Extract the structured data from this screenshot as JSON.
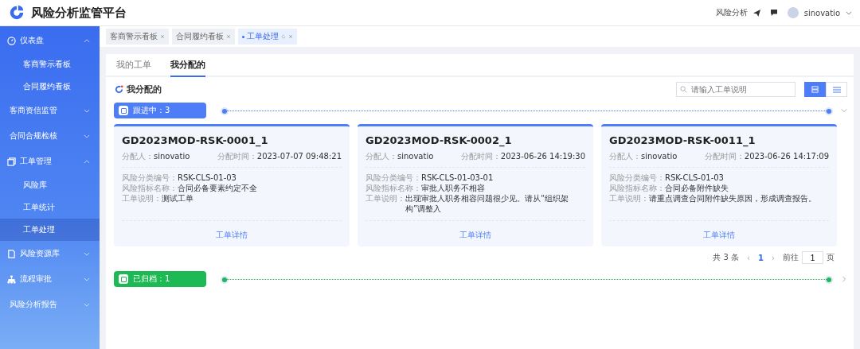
{
  "header": {
    "title": "风险分析监管平台",
    "link": "风险分析",
    "user": "sinovatio"
  },
  "sidebar": {
    "items": [
      {
        "label": "仪表盘",
        "expanded": true,
        "selected": false,
        "children": [
          {
            "label": "客商警示看板",
            "selected": false
          },
          {
            "label": "合同履约看板",
            "selected": false
          }
        ]
      },
      {
        "label": "客商资信监管",
        "expanded": false,
        "selected": false
      },
      {
        "label": "合同合规检核",
        "expanded": false,
        "selected": false
      },
      {
        "label": "工单管理",
        "expanded": true,
        "selected": false,
        "children": [
          {
            "label": "风险库",
            "selected": false
          },
          {
            "label": "工单统计",
            "selected": false
          },
          {
            "label": "工单处理",
            "selected": true
          }
        ]
      },
      {
        "label": "风险资源库",
        "expanded": false,
        "selected": false
      },
      {
        "label": "流程审批",
        "expanded": false,
        "selected": false
      },
      {
        "label": "风险分析报告",
        "expanded": false,
        "selected": false
      }
    ]
  },
  "open_tabs": [
    {
      "label": "客商警示看板",
      "selected": false
    },
    {
      "label": "合同履约看板",
      "selected": false
    },
    {
      "label": "工单处理",
      "selected": true
    }
  ],
  "page_tabs": [
    {
      "label": "我的工单",
      "selected": false
    },
    {
      "label": "我分配的",
      "selected": true
    }
  ],
  "section_title": "我分配的",
  "search": {
    "placeholder": "请输入工单说明"
  },
  "view_modes": [
    {
      "kind": "cards",
      "selected": true
    },
    {
      "kind": "list",
      "selected": false
    }
  ],
  "groups": [
    {
      "kind": "in_progress",
      "label": "跟进中：3",
      "expanded": true,
      "cards": [
        {
          "title": "GD2023MOD-RSK-0001_1",
          "assignee_label": "分配人：",
          "assignee": "sinovatio",
          "time_label": "分配时间：",
          "time": "2023-07-07 09:48:21",
          "fields": [
            {
              "label": "风险分类编号：",
              "value": "RSK-CLS-01-03"
            },
            {
              "label": "风险指标名称：",
              "value": "合同必备要素约定不全"
            },
            {
              "label": "工单说明：",
              "value": "测试工单"
            }
          ],
          "link": "工单详情"
        },
        {
          "title": "GD2023MOD-RSK-0002_1",
          "assignee_label": "分配人：",
          "assignee": "sinovatio",
          "time_label": "分配时间：",
          "time": "2023-06-26 14:19:30",
          "fields": [
            {
              "label": "风险分类编号：",
              "value": "RSK-CLS-01-03-01"
            },
            {
              "label": "风险指标名称：",
              "value": "审批人职务不相容"
            },
            {
              "label": "工单说明：",
              "value": "出现审批人职务相容问题很少见。请从“组织架构”调整入"
            }
          ],
          "link": "工单详情"
        },
        {
          "title": "GD2023MOD-RSK-0011_1",
          "assignee_label": "分配人：",
          "assignee": "sinovatio",
          "time_label": "分配时间：",
          "time": "2023-06-26 14:17:09",
          "fields": [
            {
              "label": "风险分类编号：",
              "value": "RSK-CLS-01-03"
            },
            {
              "label": "风险指标名称：",
              "value": "合同必备附件缺失"
            },
            {
              "label": "工单说明：",
              "value": "请重点调查合同附件缺失原因，形成调查报告。"
            }
          ],
          "link": "工单详情"
        }
      ],
      "pagination": {
        "total": "共 3 条",
        "prev": "‹",
        "page": "1",
        "next": "›",
        "goto": "前往",
        "goto_value": "1",
        "unit": "页"
      }
    },
    {
      "kind": "archived",
      "label": "已归档：1",
      "expanded": false
    }
  ]
}
